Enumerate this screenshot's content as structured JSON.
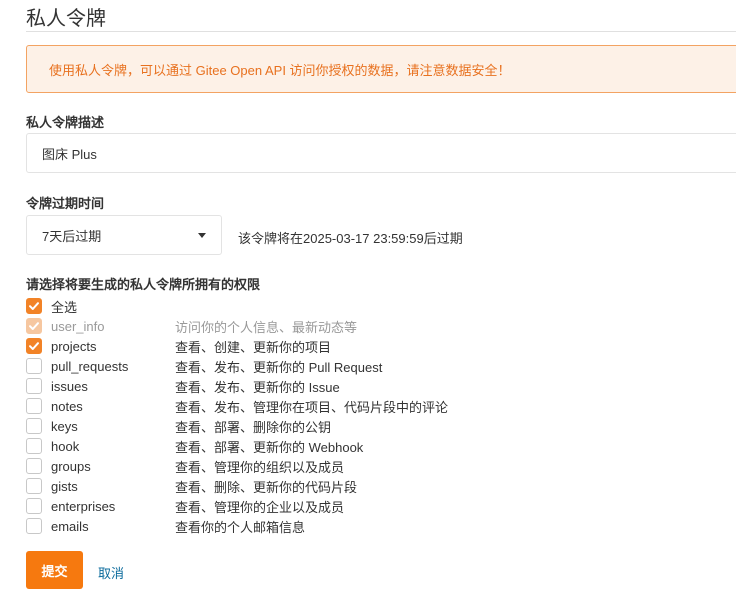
{
  "page": {
    "title": "私人令牌"
  },
  "alert": {
    "text": "使用私人令牌，可以通过 Gitee Open API 访问你授权的数据，请注意数据安全！"
  },
  "description": {
    "label": "私人令牌描述",
    "value": "图床 Plus"
  },
  "expiration": {
    "label": "令牌过期时间",
    "selected": "7天后过期",
    "note": "该令牌将在2025-03-17 23:59:59后过期"
  },
  "permissions": {
    "label": "请选择将要生成的私人令牌所拥有的权限",
    "select_all": {
      "label": "全选",
      "checked": true
    },
    "items": [
      {
        "name": "user_info",
        "desc": "访问你的个人信息、最新动态等",
        "checked": true,
        "disabled": true
      },
      {
        "name": "projects",
        "desc": "查看、创建、更新你的项目",
        "checked": true,
        "disabled": false
      },
      {
        "name": "pull_requests",
        "desc": "查看、发布、更新你的 Pull Request",
        "checked": false,
        "disabled": false
      },
      {
        "name": "issues",
        "desc": "查看、发布、更新你的 Issue",
        "checked": false,
        "disabled": false
      },
      {
        "name": "notes",
        "desc": "查看、发布、管理你在项目、代码片段中的评论",
        "checked": false,
        "disabled": false
      },
      {
        "name": "keys",
        "desc": "查看、部署、删除你的公钥",
        "checked": false,
        "disabled": false
      },
      {
        "name": "hook",
        "desc": "查看、部署、更新你的 Webhook",
        "checked": false,
        "disabled": false
      },
      {
        "name": "groups",
        "desc": "查看、管理你的组织以及成员",
        "checked": false,
        "disabled": false
      },
      {
        "name": "gists",
        "desc": "查看、删除、更新你的代码片段",
        "checked": false,
        "disabled": false
      },
      {
        "name": "enterprises",
        "desc": "查看、管理你的企业以及成员",
        "checked": false,
        "disabled": false
      },
      {
        "name": "emails",
        "desc": "查看你的个人邮箱信息",
        "checked": false,
        "disabled": false
      }
    ]
  },
  "actions": {
    "submit_label": "提交",
    "cancel_label": "取消"
  },
  "colors": {
    "accent": "#f6790f",
    "alert_bg": "#fdf1e7",
    "alert_border": "#f3a362",
    "alert_text": "#e8711f",
    "link": "#0b6b9c"
  }
}
